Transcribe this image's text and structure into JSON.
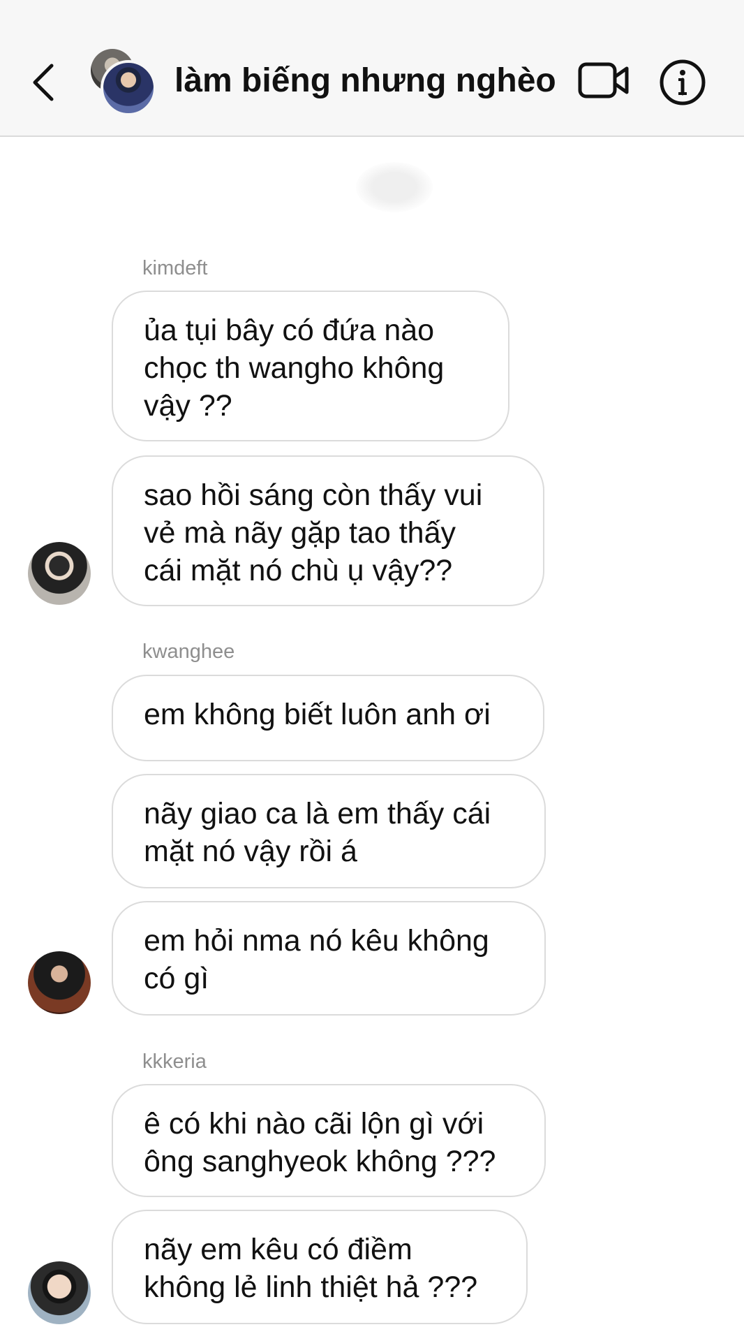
{
  "header": {
    "title": "làm biếng nhưng nghèo",
    "back_icon": "chevron-left-icon",
    "video_icon": "video-camera-icon",
    "info_icon": "info-icon"
  },
  "messages": [
    {
      "sender": "kimdeft",
      "text_lines": [
        "ủa tụi bây có đứa nào",
        "chọc th wangho không",
        "vậy ??"
      ]
    },
    {
      "text_lines": [
        "sao hồi sáng còn thấy vui",
        "vẻ mà nãy gặp tao thấy",
        "cái mặt nó chù ụ vậy??"
      ]
    },
    {
      "sender": "kwanghee",
      "text_lines": [
        "em không biết luôn anh ơi"
      ]
    },
    {
      "text_lines": [
        "nãy giao ca là em thấy cái",
        "mặt nó vậy rồi á"
      ]
    },
    {
      "text_lines": [
        "em hỏi nma nó kêu không",
        "có gì"
      ]
    },
    {
      "sender": "kkkeria",
      "text_lines": [
        "ê có khi nào cãi lộn gì với",
        "ông sanghyeok không ???"
      ]
    },
    {
      "text_lines": [
        "nãy em kêu có điềm",
        "không lẻ linh thiệt hả ???"
      ]
    }
  ]
}
